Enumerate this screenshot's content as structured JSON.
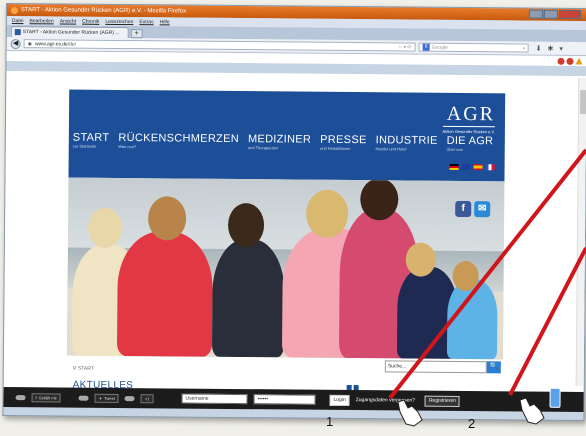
{
  "browser": {
    "title": "START - Aktion Gesunder Rücken (AGR) e.V. - Mozilla Firefox",
    "menu": [
      "Datei",
      "Bearbeiten",
      "Ansicht",
      "Chronik",
      "Lesezeichen",
      "Extras",
      "Hilfe"
    ],
    "tab_label": "START - Aktion Gesunder Rücken (AGR) ...",
    "tab_add": "+",
    "url_domain": "www.agr-ev.de",
    "url_path": "/de/",
    "search_placeholder": "Google",
    "search_engine_letter": "8"
  },
  "site": {
    "logo": "AGR",
    "logo_sub": "Aktion Gesunder Rücken e.V.",
    "nav": [
      {
        "main": "START",
        "sub": "zur Startseite"
      },
      {
        "main": "RÜCKENSCHMERZEN",
        "sub": "Was nun?"
      },
      {
        "main": "MEDIZINER",
        "sub": "und Therapeuten"
      },
      {
        "main": "PRESSE",
        "sub": "und Redaktionen"
      },
      {
        "main": "INDUSTRIE",
        "sub": "Handel und Hotel"
      },
      {
        "main": "DIE AGR",
        "sub": "Über uns"
      }
    ],
    "social": [
      "f",
      "✉"
    ],
    "breadcrumb": "START",
    "section_title": "AKTUELLES",
    "search_placeholder": "Suche...",
    "search_button": "🔍",
    "flag_colors": [
      "#000000",
      "#1a3fa0",
      "#c8102e",
      "#2255bb"
    ]
  },
  "bottombar": {
    "like_label": "Gefällt mir",
    "tweet_label": "Tweet",
    "plus_label": "+1",
    "username_placeholder": "Username",
    "password_value": "••••••",
    "login_label": "Login",
    "forgot_label": "Zugangsdaten vergessen?",
    "register_label": "Registrieren"
  },
  "annotations": {
    "label_1": "1",
    "label_2": "2",
    "arrow_color": "#d0161c"
  }
}
